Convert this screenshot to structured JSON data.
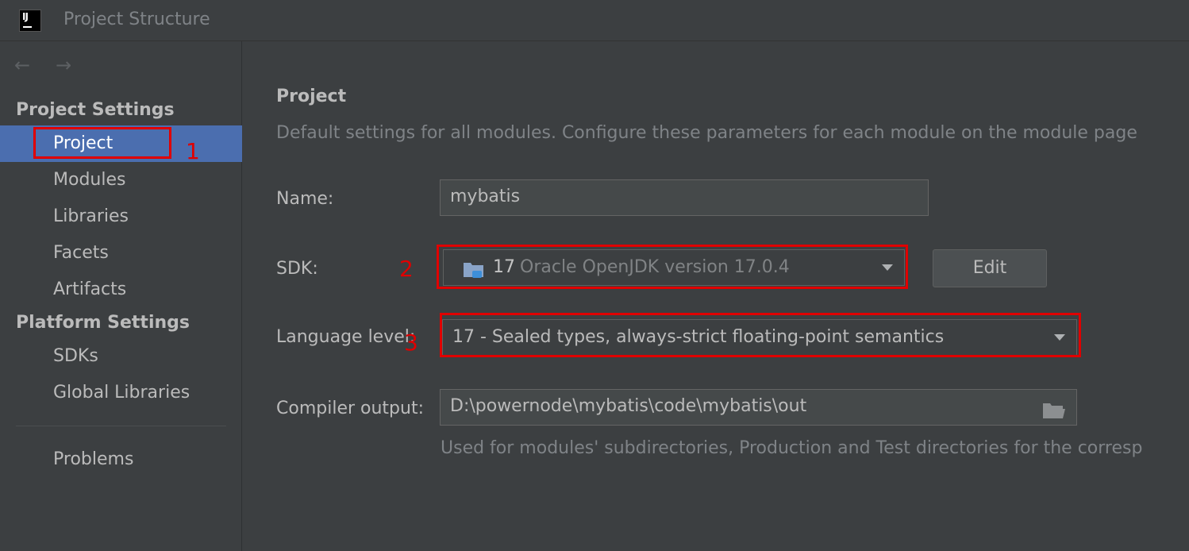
{
  "window": {
    "title": "Project Structure",
    "app_icon": "intellij-idea-icon"
  },
  "nav": {
    "back_icon": "arrow-left-icon",
    "forward_icon": "arrow-right-icon",
    "back": "←",
    "forward": "→"
  },
  "sidebar": {
    "project_settings_header": "Project Settings",
    "project_settings_items": [
      {
        "label": "Project",
        "selected": true
      },
      {
        "label": "Modules"
      },
      {
        "label": "Libraries"
      },
      {
        "label": "Facets"
      },
      {
        "label": "Artifacts"
      }
    ],
    "platform_settings_header": "Platform Settings",
    "platform_settings_items": [
      {
        "label": "SDKs"
      },
      {
        "label": "Global Libraries"
      }
    ],
    "problems_label": "Problems"
  },
  "main": {
    "title": "Project",
    "description": "Default settings for all modules. Configure these parameters for each module on the module page",
    "name_label": "Name:",
    "name_value": "mybatis",
    "sdk_label": "SDK:",
    "sdk_version": "17",
    "sdk_detail": "Oracle OpenJDK version 17.0.4",
    "sdk_icon": "folder-jdk-icon",
    "edit_button": "Edit",
    "language_level_label": "Language level:",
    "language_level_value": "17 - Sealed types, always-strict floating-point semantics",
    "compiler_output_label": "Compiler output:",
    "compiler_output_value": "D:\\powernode\\mybatis\\code\\mybatis\\out",
    "compiler_output_icon": "open-folder-icon",
    "compiler_output_hint": "Used for modules' subdirectories, Production and Test directories for the corresp"
  },
  "annotations": {
    "marker_1": "1",
    "marker_2": "2",
    "marker_3": "3",
    "color": "#e00000"
  }
}
